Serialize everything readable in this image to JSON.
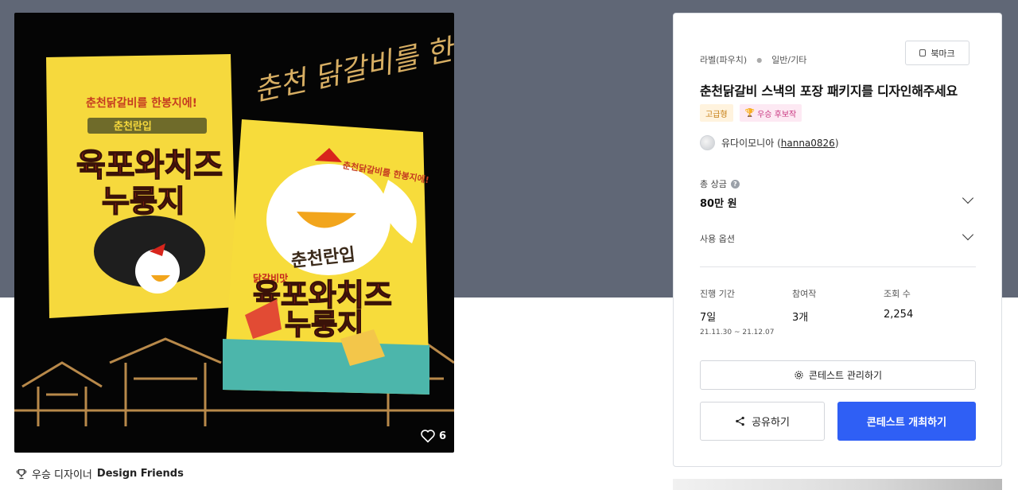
{
  "colors": {
    "hero_bg": "#606776",
    "accent_blue": "#2f5ff5",
    "premium_tag_bg": "#fff3de",
    "premium_tag_text": "#c47b0e",
    "winner_tag_bg": "#fde9f3",
    "winner_tag_text": "#c8357f"
  },
  "product_image": {
    "slogan": "춘천 닭갈비를 한봉지에!",
    "brand": "춘천란입",
    "flavor_line": "닭갈비맛",
    "product_name_1": "육포와치즈",
    "product_name_2": "누룽지",
    "pouch_small_note": "춘천닭갈비를 한봉지에!",
    "like_icon": "heart-outline-icon",
    "like_count": "6"
  },
  "winner": {
    "icon": "trophy-icon",
    "prefix": "우승 디자이너",
    "designer": "Design Friends"
  },
  "panel": {
    "category": "라벨(파우치)",
    "subcategory": "일반/기타",
    "bookmark_label": "북마크",
    "title": "춘천닭갈비 스낵의 포장 패키지를 디자인해주세요",
    "tags": {
      "premium": "고급형",
      "winner": "우승 후보작"
    },
    "host_name": "유다이모니아",
    "host_handle": "hanna0826",
    "prize_label": "총 상금",
    "prize_value": "80만 원",
    "options_label": "사용 옵션",
    "stats": {
      "period_label": "진행 기간",
      "period_value": "7일",
      "period_dates": "21.11.30 ~ 21.12.07",
      "entries_label": "참여작",
      "entries_value": "3개",
      "views_label": "조회 수",
      "views_value": "2,254"
    },
    "manage_label": "콘테스트 관리하기",
    "share_label": "공유하기",
    "host_contest_label": "콘테스트 개최하기"
  }
}
